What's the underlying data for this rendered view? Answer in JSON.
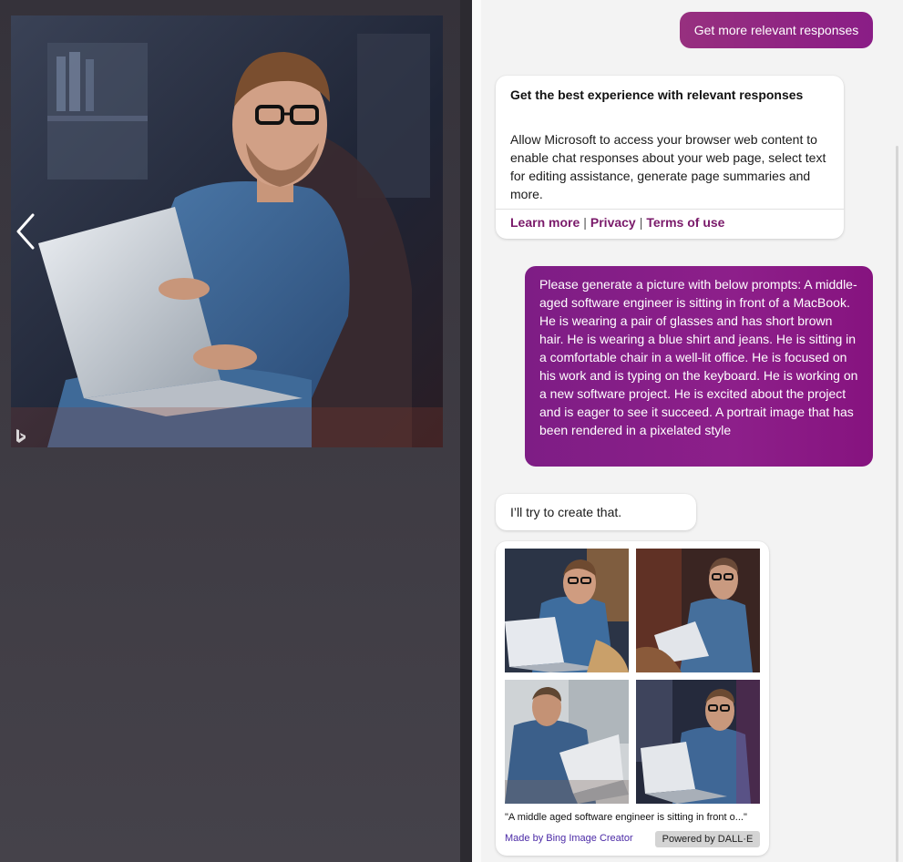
{
  "viewer": {
    "prev_icon": "chevron-left-icon",
    "watermark_icon": "bing-logo-icon"
  },
  "chat": {
    "suggestion_button": "Get more relevant responses",
    "info_card": {
      "title": "Get the best experience with relevant responses",
      "body": "Allow Microsoft to access your browser web content to enable chat responses about your web page, select text for editing assistance, generate page summaries and more.",
      "links": [
        "Learn more",
        "Privacy",
        "Terms of use"
      ],
      "link_separator": "|"
    },
    "user_message": "Please generate a picture with below prompts: A middle-aged software engineer is sitting in front of a MacBook. He is wearing a pair of glasses and has short brown hair. He is wearing a blue shirt and jeans. He is sitting in a comfortable chair in a well-lit office. He is focused on his work and is typing on the keyboard. He is working on a new software project. He is excited about the project and is eager to see it succeed. A portrait image that has been rendered in a pixelated style",
    "bot_message": "I’ll try to create that.",
    "gallery": {
      "caption": "\"A middle aged software engineer is sitting in front o...\"",
      "made_by": "Made by Bing Image Creator",
      "powered_by": "Powered by DALL·E"
    }
  },
  "colors": {
    "accent_purple": "#8a1d86",
    "link_purple": "#7a1a6a",
    "panel_bg": "#f3f3f3",
    "viewer_bg": "#3b3a40"
  }
}
